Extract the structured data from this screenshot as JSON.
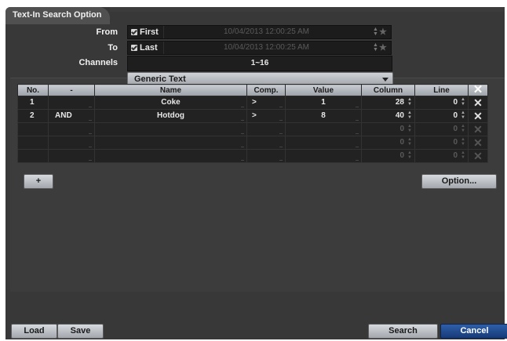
{
  "window": {
    "title": "Text-In Search Option"
  },
  "form": {
    "from_label": "From",
    "to_label": "To",
    "channels_label": "Channels",
    "first_label": "First",
    "last_label": "Last",
    "from_datetime": "10/04/2013  12:00:25 AM",
    "to_datetime": "10/04/2013  12:00:25 AM",
    "channels_value": "1~16",
    "text_type": "Generic Text"
  },
  "table": {
    "headers": [
      "No.",
      "-",
      "Name",
      "Comp.",
      "Value",
      "Column",
      "Line"
    ],
    "rows": [
      {
        "no": "1",
        "op": "",
        "name": "Coke",
        "comp": ">",
        "value": "1",
        "column": "28",
        "line": "0"
      },
      {
        "no": "2",
        "op": "AND",
        "name": "Hotdog",
        "comp": ">",
        "value": "8",
        "column": "40",
        "line": "0"
      },
      {
        "no": "",
        "op": "",
        "name": "",
        "comp": "",
        "value": "",
        "column": "0",
        "line": "0"
      },
      {
        "no": "",
        "op": "",
        "name": "",
        "comp": "",
        "value": "",
        "column": "0",
        "line": "0"
      },
      {
        "no": "",
        "op": "",
        "name": "",
        "comp": "",
        "value": "",
        "column": "0",
        "line": "0"
      }
    ]
  },
  "buttons": {
    "add": "+",
    "option": "Option...",
    "load": "Load",
    "save": "Save",
    "search": "Search",
    "cancel": "Cancel"
  },
  "icons": {
    "delete": "x-icon",
    "spin": "spinner-icon",
    "star": "star-icon",
    "check": "checkbox-icon"
  }
}
